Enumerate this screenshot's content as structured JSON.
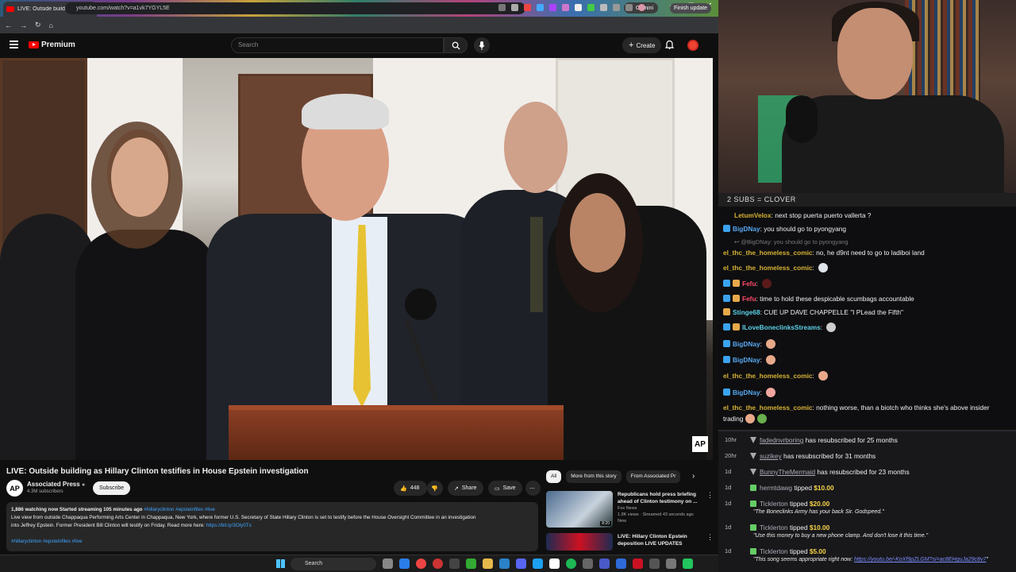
{
  "browser": {
    "tab_title": "LIVE: Outside building as Hi...",
    "url": "youtube.com/watch?v=a1vk7YGYL5E",
    "gemini_label": "Gemini",
    "finish_update": "Finish update"
  },
  "youtube": {
    "logo_text": "Premium",
    "search_placeholder": "Search",
    "create_label": "Create",
    "video_title": "LIVE: Outside building as Hillary Clinton testifies in House Epstein investigation",
    "channel": {
      "logo": "AP",
      "name": "Associated Press",
      "subs": "4.3M subscribers",
      "subscribe": "Subscribe"
    },
    "actions": {
      "likes": "448",
      "share": "Share",
      "save": "Save"
    },
    "bug": "AP",
    "description": {
      "meta": "1,886 watching now  Started streaming 105 minutes ago",
      "tags_inline": "#hillaryclinton #epsteinfiles #live",
      "line1": "Live view from outside Chappaqua Performing Arts Center in Chappaqua, New York, where former U.S. Secretary of State Hillary Clinton is set to testify before the House Oversight Committee in an investigation",
      "line2": "into Jeffrey Epstein. Former President Bill Clinton will testify on Friday. Read more here:",
      "link": "https://bit.ly/3Oly0Tx",
      "tags_bottom": "#hillaryclinton #epsteinfiles #live"
    },
    "chips": [
      "All",
      "More from this story",
      "From Associated Pr"
    ],
    "recommendations": [
      {
        "title": "Republicans hold press briefing ahead of Clinton testimony on ...",
        "channel": "Fox News",
        "stats": "1.8K views · Streamed 43 seconds ago",
        "badge": "New",
        "duration": "8:20"
      },
      {
        "title": "LIVE: Hillary Clinton Epstein deposition LIVE UPDATES",
        "channel": "",
        "stats": "",
        "badge": "",
        "duration": ""
      }
    ]
  },
  "taskbar": {
    "search": "Search"
  },
  "stream": {
    "banner": "2 SUBS = CLOVER",
    "chat": [
      {
        "user": "LetumVelox",
        "color": "#d6b236",
        "text": "next stop puerta puerto vallerta ?"
      },
      {
        "user": "BigDNay",
        "color": "#57a8f2",
        "text": "you should go to pyongyang"
      },
      {
        "reply": "@BigDNay: you should go to pyongyang"
      },
      {
        "user": "el_thc_the_homeless_comic",
        "color": "#d6b236",
        "text": "no, he d9nt need to go to ladiboi land"
      },
      {
        "user": "el_thc_the_homeless_comic",
        "color": "#d6b236",
        "text": ""
      },
      {
        "user": "Fefu",
        "color": "#ff4a6a",
        "text": ""
      },
      {
        "user": "Fefu",
        "color": "#ff4a6a",
        "text": "time to hold these despicable scumbags accountable"
      },
      {
        "user": "Stinge68",
        "color": "#5bd0e6",
        "text": "CUE UP DAVE CHAPPELLE \"I PLead the Fifth\""
      },
      {
        "user": "ILoveBoneclinksStreams",
        "color": "#5bd0e6",
        "text": ""
      },
      {
        "user": "BigDNay",
        "color": "#57a8f2",
        "text": ""
      },
      {
        "user": "BigDNay",
        "color": "#57a8f2",
        "text": ""
      },
      {
        "user": "el_thc_the_homeless_comic",
        "color": "#d6b236",
        "text": ""
      },
      {
        "user": "BigDNay",
        "color": "#57a8f2",
        "text": ""
      },
      {
        "user": "el_thc_the_homeless_comic",
        "color": "#d6b236",
        "text": "nothing worse, than a biotch who thinks she's above insider"
      },
      {
        "cont": "trading"
      }
    ],
    "events": [
      {
        "time": "10hr",
        "name": "fadednvrboring",
        "text": "has resubscribed for 25 months"
      },
      {
        "time": "20hr",
        "name": "suzikey",
        "text": "has resubscribed for 31 months"
      },
      {
        "time": "1d",
        "name": "BunnyTheMermaid",
        "text": "has resubscribed for 23 months"
      },
      {
        "time": "1d",
        "name": "hermtdawg",
        "text": "tipped",
        "amount": "$10.00"
      },
      {
        "time": "1d",
        "name": "Ticklerton",
        "text": "tipped",
        "amount": "$20.00",
        "quote": "\"The Boneclinks Army has your back Sir. Godspeed.\""
      },
      {
        "time": "1d",
        "name": "Ticklerton",
        "text": "tipped",
        "amount": "$10.00",
        "quote": "\"Use this money to buy a new phone clamp. And don't lose it this time.\""
      },
      {
        "time": "1d",
        "name": "Ticklerton",
        "text": "tipped",
        "amount": "$5.00",
        "quote": "\"This song seems appropriate right now: ",
        "quote_link": "https://youtu.be/-KoXf9pZLGM?si=ac8EHguJa29c8v7",
        "quote_end": "\""
      }
    ]
  }
}
